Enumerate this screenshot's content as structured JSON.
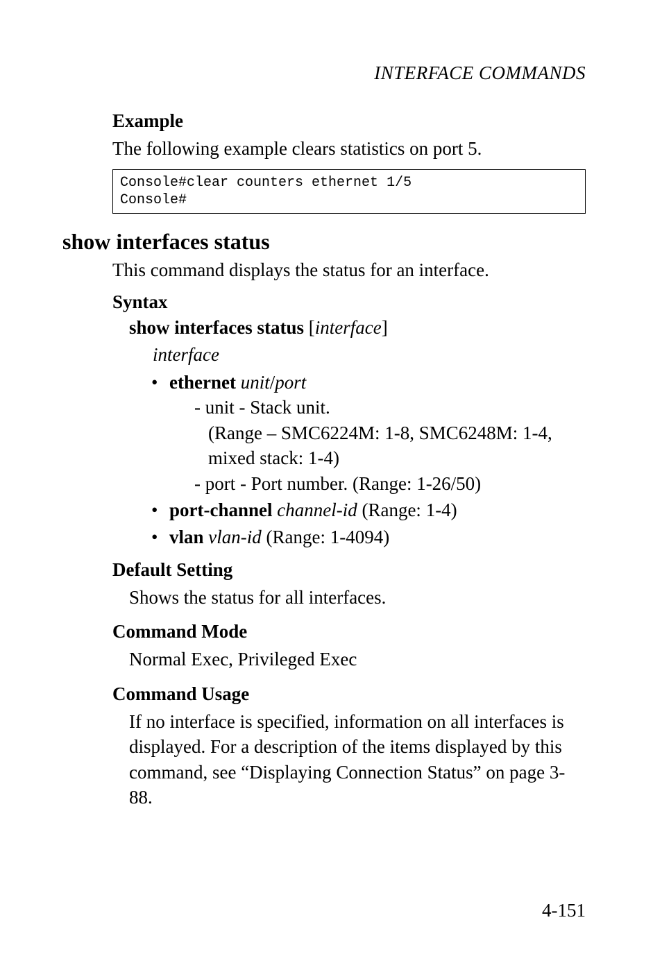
{
  "running_head": "INTERFACE COMMANDS",
  "example": {
    "heading": "Example",
    "intro": "The following example clears statistics on port 5.",
    "code": "Console#clear counters ethernet 1/5\nConsole#"
  },
  "command": {
    "title": "show interfaces status",
    "description": "This command displays the status for an interface."
  },
  "syntax": {
    "heading": "Syntax",
    "line_part1": "show interfaces status",
    "line_part2": " [",
    "line_part3": "interface",
    "line_part4": "]",
    "param": "interface",
    "bullets": {
      "ethernet": {
        "kw": "ethernet",
        "arg": "unit",
        "slash": "/",
        "arg2": "port",
        "unit_label": "- unit - Stack unit.",
        "unit_range": "(Range – SMC6224M: 1-8, SMC6248M: 1-4, mixed stack: 1-4)",
        "port_label": "- port - Port number. (Range: 1-26/50)"
      },
      "portchannel": {
        "kw": "port-channel",
        "arg": "channel-id",
        "rest": " (Range: 1-4)"
      },
      "vlan": {
        "kw": "vlan",
        "arg": "vlan-id",
        "rest": " (Range: 1-4094)"
      }
    }
  },
  "default_setting": {
    "heading": "Default Setting",
    "body": "Shows the status for all interfaces."
  },
  "command_mode": {
    "heading": "Command Mode",
    "body": "Normal Exec, Privileged Exec"
  },
  "command_usage": {
    "heading": "Command Usage",
    "body": "If no interface is specified, information on all interfaces is displayed. For a description of the items displayed by this command, see “Displaying Connection Status” on page 3-88."
  },
  "page_number": "4-151"
}
